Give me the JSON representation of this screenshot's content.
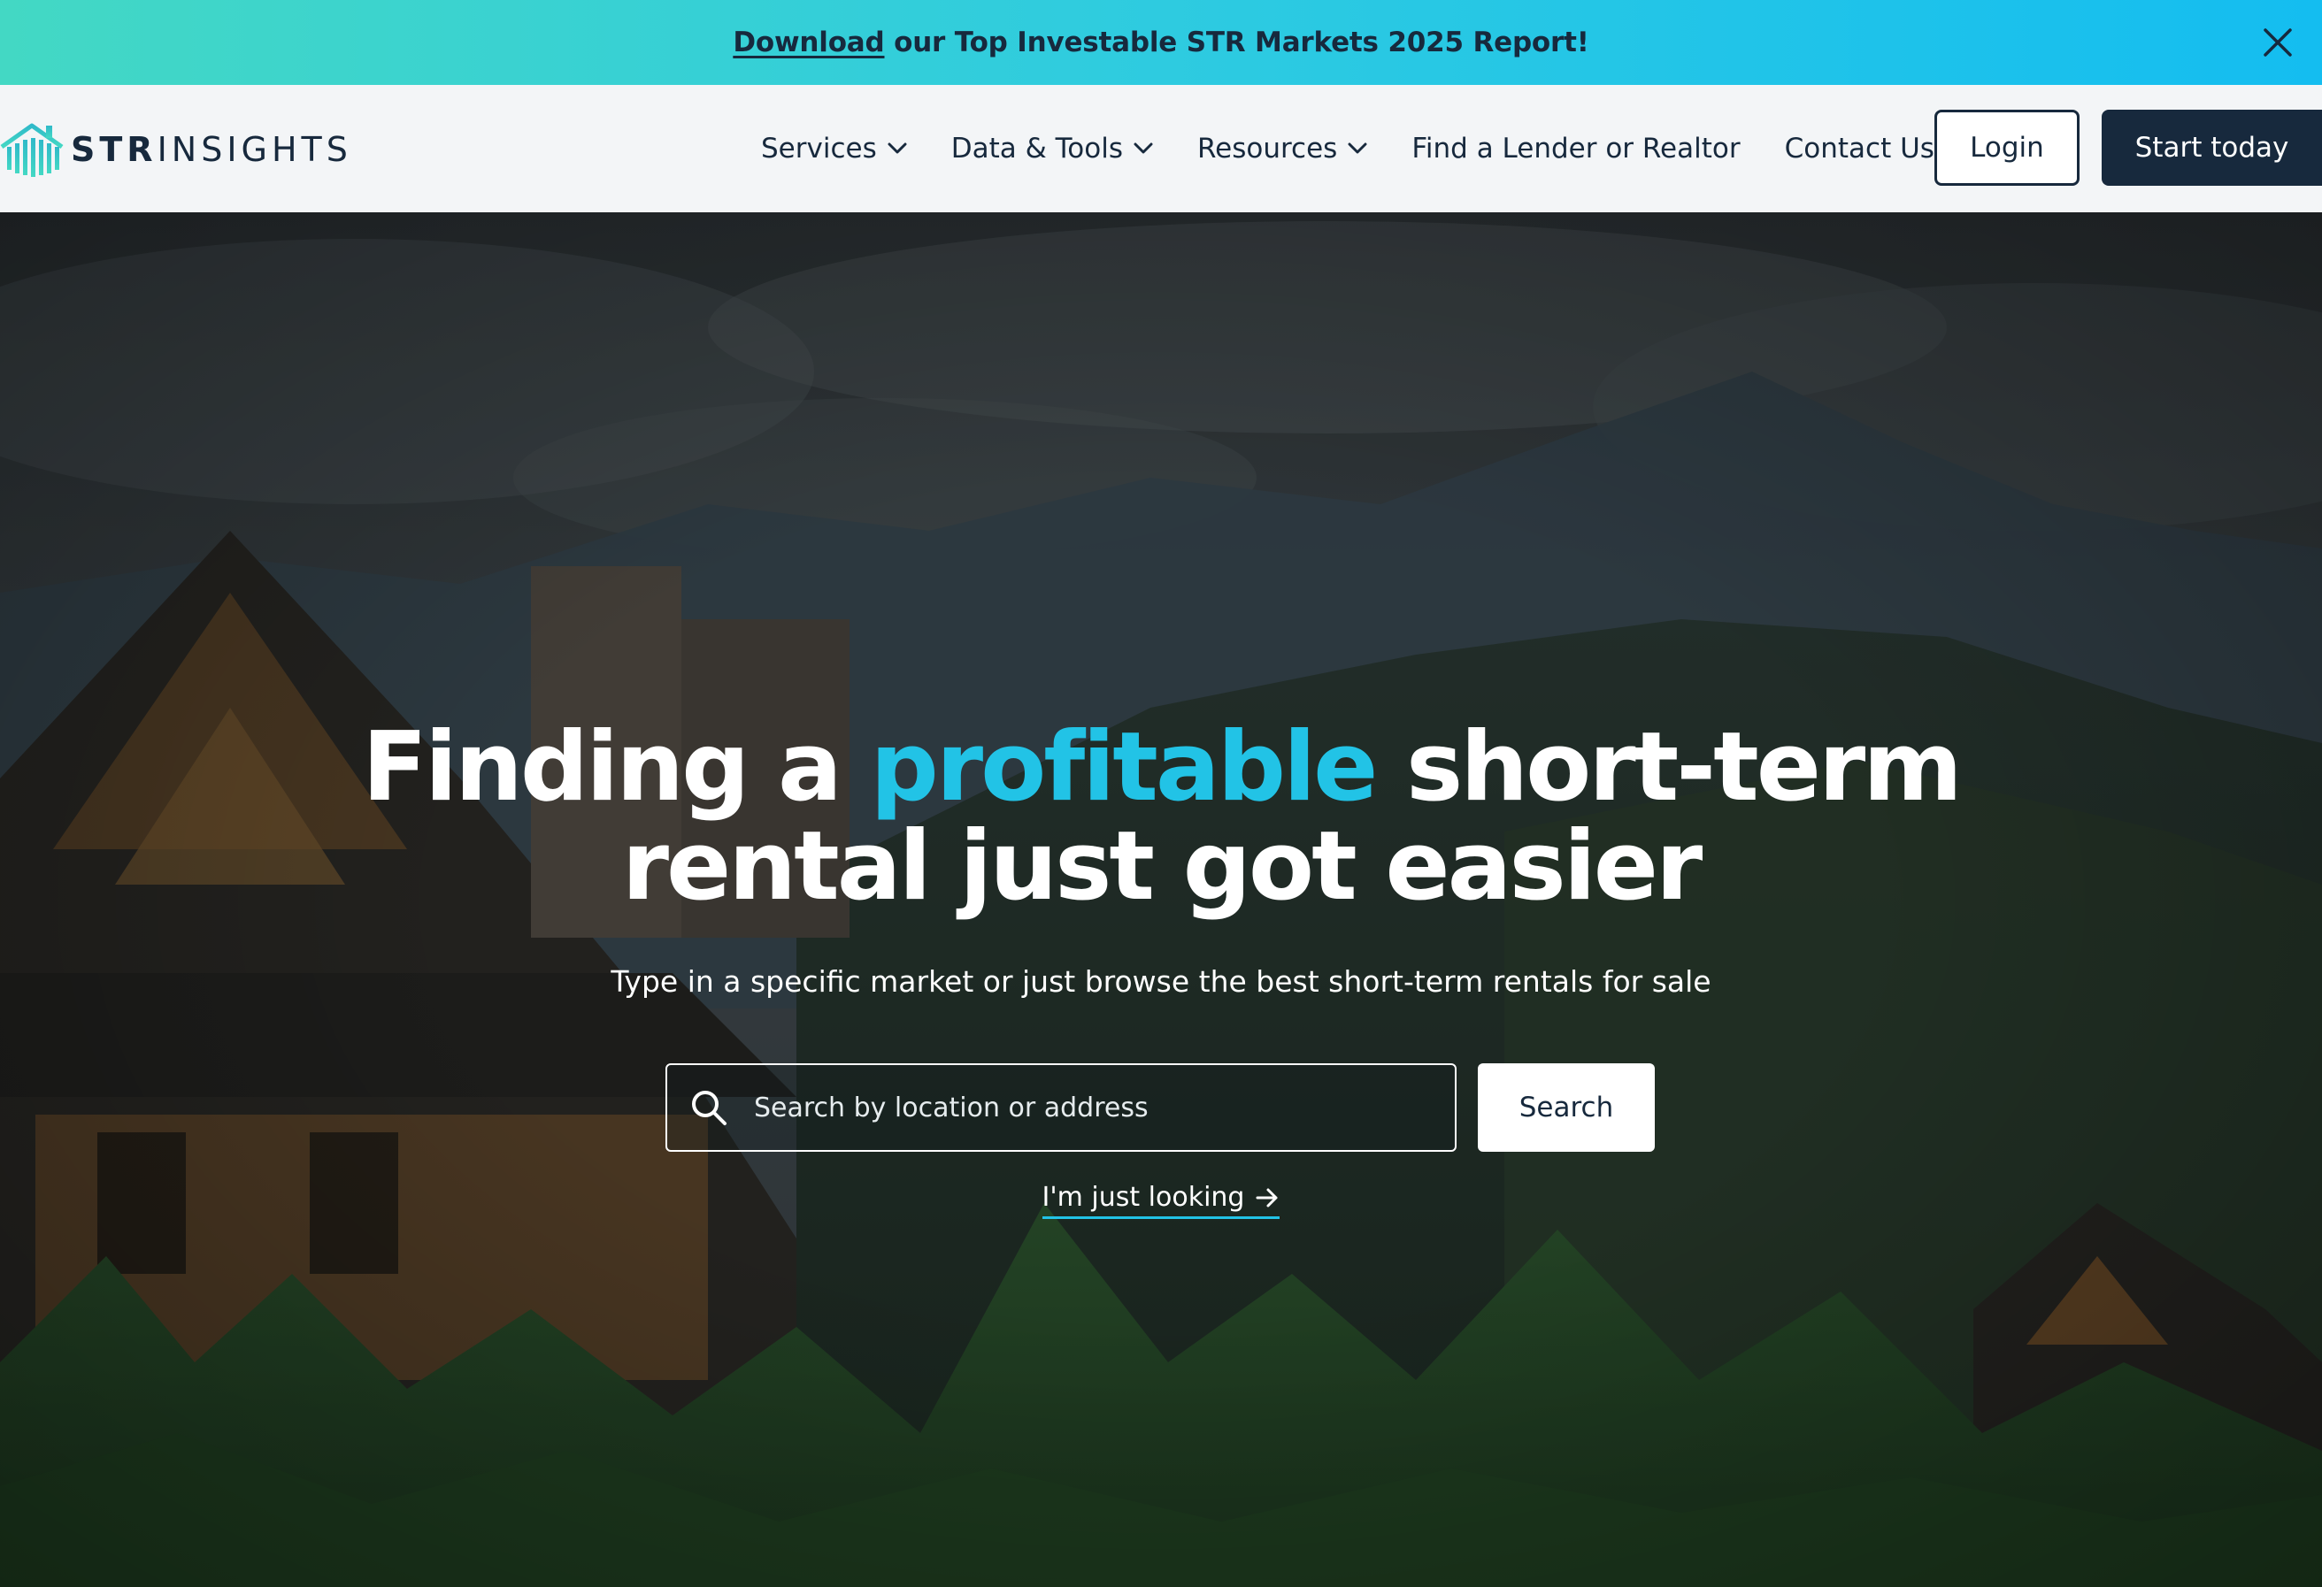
{
  "announcement": {
    "link_text": "Download",
    "text": " our Top Investable STR Markets 2025 Report!",
    "close_icon": "close-icon"
  },
  "header": {
    "logo": {
      "bold": "STR",
      "regular": "INSIGHTS",
      "icon": "building-logo-icon"
    },
    "nav": [
      {
        "label": "Services",
        "has_dropdown": true
      },
      {
        "label": "Data & Tools",
        "has_dropdown": true
      },
      {
        "label": "Resources",
        "has_dropdown": true
      },
      {
        "label": "Find a Lender or Realtor",
        "has_dropdown": false
      },
      {
        "label": "Contact Us",
        "has_dropdown": false
      }
    ],
    "login_label": "Login",
    "start_label": "Start today"
  },
  "hero": {
    "title_part1": "Finding a ",
    "title_accent": "profitable",
    "title_part2": " short-term",
    "title_line2": "rental just got easier",
    "subtitle": "Type in a specific market or just browse the best short-term rentals for sale",
    "search": {
      "placeholder": "Search by location or address",
      "value": "",
      "button_label": "Search",
      "icon": "search-icon"
    },
    "just_looking_label": "I'm just looking",
    "just_looking_icon": "arrow-right-icon"
  },
  "colors": {
    "navy": "#17293d",
    "accent_cyan": "#22c3e6",
    "banner_gradient_start": "#43d8c4",
    "banner_gradient_end": "#14bdf0",
    "header_bg": "#f3f5f7"
  }
}
